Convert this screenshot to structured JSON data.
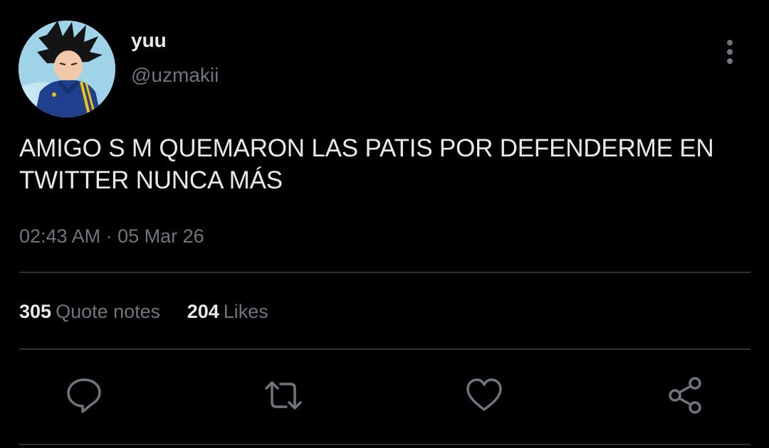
{
  "author": {
    "display_name": "yuu",
    "handle": "@uzmakii"
  },
  "tweet": {
    "text": "AMIGO S M QUEMARON LAS PATIS POR DEFENDERME EN TWITTER NUNCA MÁS",
    "timestamp": "02:43 AM · 05 Mar 26"
  },
  "stats": {
    "quotes_count": "305",
    "quotes_label": "Quote notes",
    "likes_count": "204",
    "likes_label": "Likes"
  },
  "icons": {
    "more": "more-vertical-icon",
    "reply": "reply-icon",
    "retweet": "retweet-icon",
    "like": "heart-icon",
    "share": "share-icon"
  },
  "colors": {
    "background": "#000000",
    "primary_text": "#e7e9ea",
    "secondary_text": "#6e767d",
    "divider": "#2f3336",
    "icon": "#6e767d"
  }
}
